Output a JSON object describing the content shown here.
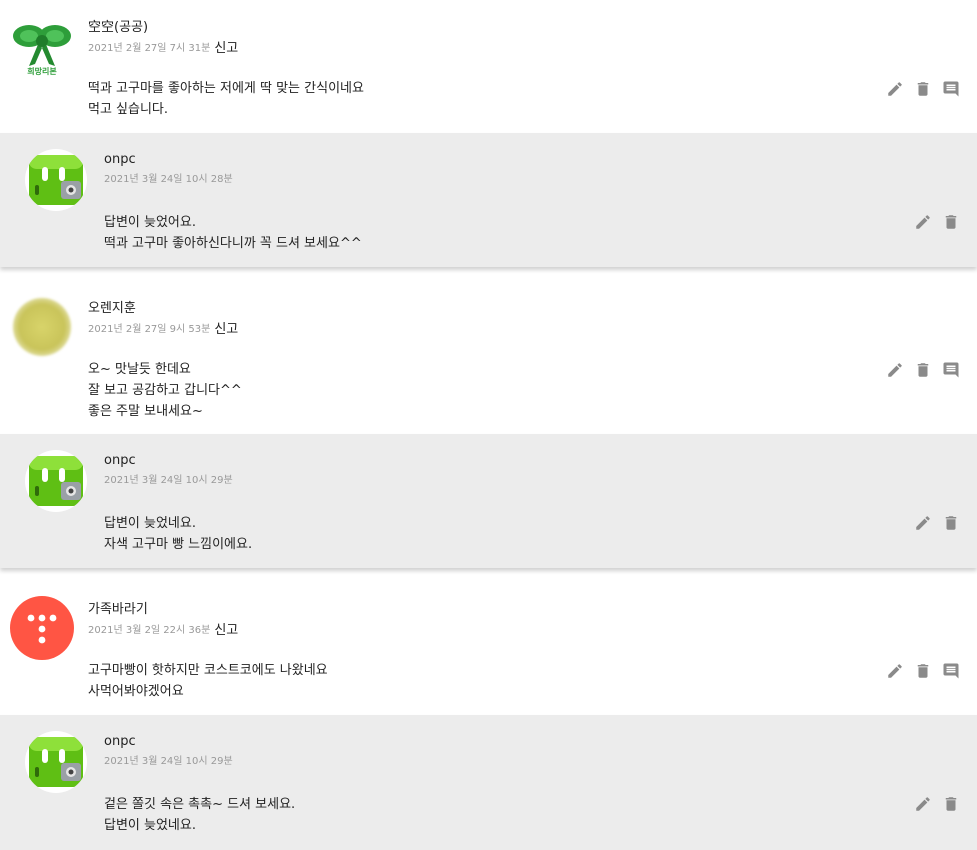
{
  "comments": [
    {
      "author": "空空(공공)",
      "timestamp": "2021년 2월 27일 7시 31분",
      "report_label": "신고",
      "avatar_caption": "희망리본",
      "lines": [
        "떡과 고구마를 좋아하는 저에게 딱 맞는 간식이네요",
        "먹고 싶습니다."
      ],
      "reply": {
        "author": "onpc",
        "timestamp": "2021년 3월 24일 10시 28분",
        "lines": [
          "답변이 늦었어요.",
          "떡과 고구마 좋아하신다니까 꼭 드셔 보세요^^"
        ]
      }
    },
    {
      "author": "오렌지훈",
      "timestamp": "2021년 2월 27일 9시 53분",
      "report_label": "신고",
      "lines": [
        "오~ 맛날듯 한데요",
        "잘 보고 공감하고 갑니다^^",
        "좋은 주말 보내세요~"
      ],
      "reply": {
        "author": "onpc",
        "timestamp": "2021년 3월 24일 10시 29분",
        "lines": [
          "답변이 늦었네요.",
          "자색 고구마 빵 느낌이에요."
        ]
      }
    },
    {
      "author": "가족바라기",
      "timestamp": "2021년 3월 2일 22시 36분",
      "report_label": "신고",
      "lines": [
        "고구마빵이 핫하지만 코스트코에도 나왔네요",
        "사먹어봐야겠어요"
      ],
      "reply": {
        "author": "onpc",
        "timestamp": "2021년 3월 24일 10시 29분",
        "lines": [
          "겉은 쫄깃 속은 촉촉~ 드셔 보세요.",
          "답변이 늦었네요."
        ]
      }
    }
  ],
  "colors": {
    "reply_bg": "#ececec",
    "icon_gray": "#8a8a8a",
    "tistory_red": "#ff5544"
  },
  "icons": [
    "edit-icon",
    "delete-icon",
    "reply-icon"
  ]
}
